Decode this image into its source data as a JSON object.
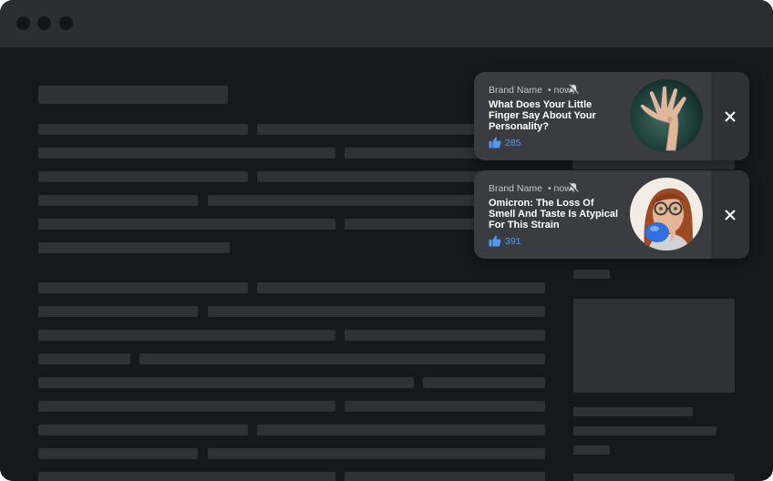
{
  "window": {
    "controls": [
      "close-dot",
      "minimize-dot",
      "zoom-dot"
    ]
  },
  "notifications": [
    {
      "brand": "Brand Name",
      "time": "• now",
      "headline": "What Does Your Little Finger Say About Your Personality?",
      "likes": "285",
      "icon": "bell-icon",
      "accent": "#4f9bf2"
    },
    {
      "brand": "Brand Name",
      "time": "• now",
      "headline": "Omicron: The Loss Of Smell And Taste Is Atypical For This Strain",
      "likes": "391",
      "icon": "bell-icon",
      "accent": "#4f9bf2"
    }
  ],
  "colors": {
    "background": "#17181b",
    "titlebar": "#2c2e32",
    "placeholder": "#2f3135",
    "card": "#3a3c41"
  }
}
